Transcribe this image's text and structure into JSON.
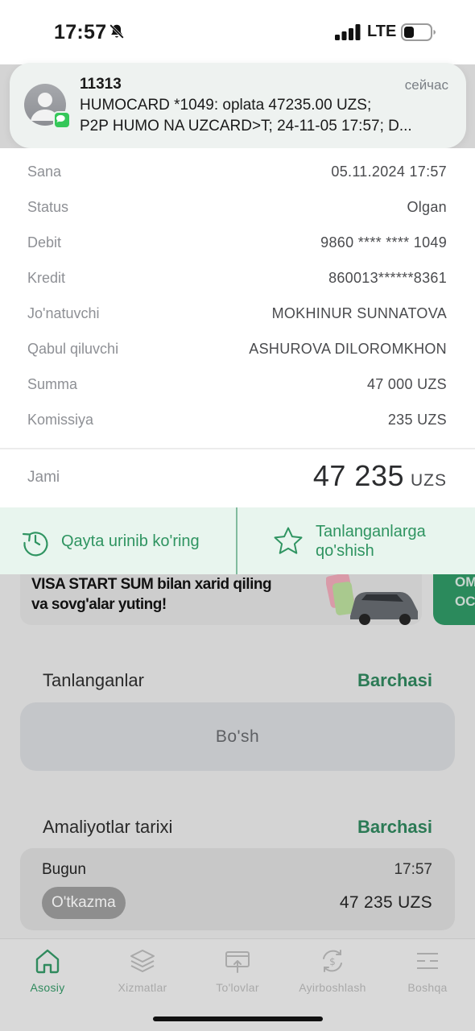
{
  "status_bar": {
    "time": "17:57",
    "network": "LTE",
    "icons": [
      "bell-slash-icon",
      "signal-icon",
      "battery-icon"
    ]
  },
  "notification": {
    "sender": "11313",
    "time": "сейчас",
    "line1": "HUMOCARD *1049: oplata 47235.00 UZS;",
    "line2": "P2P HUMO NA UZCARD>T; 24-11-05 17:57;  D...",
    "icons": [
      "avatar-icon",
      "messages-icon"
    ]
  },
  "details": [
    {
      "label": "Sana",
      "value": "05.11.2024 17:57"
    },
    {
      "label": "Status",
      "value": "Olgan"
    },
    {
      "label": "Debit",
      "value": "9860 **** **** 1049"
    },
    {
      "label": "Kredit",
      "value": "860013******8361"
    },
    {
      "label": "Jo'natuvchi",
      "value": "MOKHINUR SUNNATOVA"
    },
    {
      "label": "Qabul qiluvchi",
      "value": "ASHUROVA DILOROMKHON"
    },
    {
      "label": "Summa",
      "value": "47 000 UZS"
    },
    {
      "label": "Komissiya",
      "value": "235 UZS"
    }
  ],
  "total": {
    "label": "Jami",
    "amount": "47 235",
    "currency": "UZS"
  },
  "actions": {
    "retry_label": "Qayta urinib ko'ring",
    "favorite_line1": "Tanlanganlarga",
    "favorite_line2": "qo'shish"
  },
  "banner": {
    "line1": "VISA START SUM bilan xarid qiling",
    "line2": "va sovg'alar yuting!",
    "side_line1": "OM",
    "side_line2": "OC"
  },
  "favorites": {
    "title": "Tanlanganlar",
    "link": "Barchasi",
    "empty": "Bo'sh"
  },
  "history": {
    "title": "Amaliyotlar tarixi",
    "link": "Barchasi",
    "day": "Bugun",
    "time": "17:57",
    "tag": "O'tkazma",
    "amount": "47 235 UZS"
  },
  "tabbar": [
    {
      "label": "Asosiy",
      "icon": "home-icon",
      "active": true
    },
    {
      "label": "Xizmatlar",
      "icon": "layers-icon",
      "active": false
    },
    {
      "label": "To'lovlar",
      "icon": "payment-icon",
      "active": false
    },
    {
      "label": "Ayirboshlash",
      "icon": "exchange-icon",
      "active": false
    },
    {
      "label": "Boshqa",
      "icon": "menu-icon",
      "active": false
    }
  ],
  "colors": {
    "accent": "#2f9461",
    "action_bg": "#e8f5ee",
    "dim_bg": "#d4d4d4"
  }
}
